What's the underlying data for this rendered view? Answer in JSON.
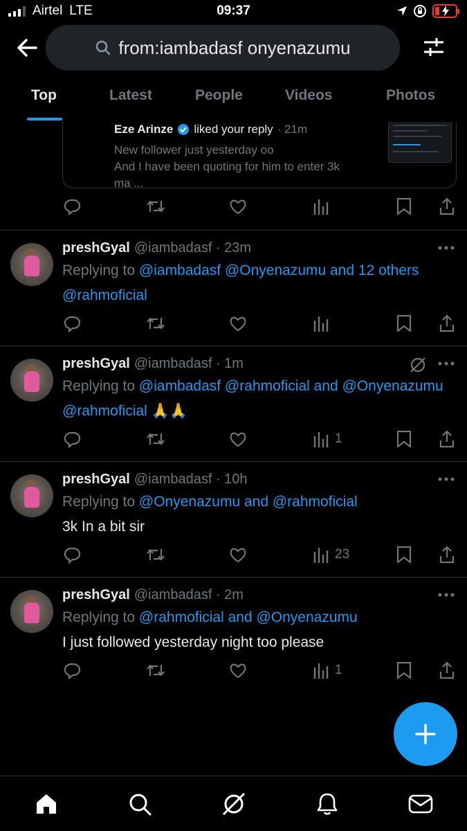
{
  "status_bar": {
    "carrier": "Airtel",
    "network": "LTE",
    "time": "09:37"
  },
  "search": {
    "query": "from:iambadasf onyenazumu"
  },
  "tabs": [
    {
      "label": "Top",
      "active": true
    },
    {
      "label": "Latest",
      "active": false
    },
    {
      "label": "People",
      "active": false
    },
    {
      "label": "Videos",
      "active": false
    },
    {
      "label": "Photos",
      "active": false
    }
  ],
  "quoted_card": {
    "name": "Eze Arinze",
    "action": "liked your reply",
    "time": "· 21m",
    "line1": "New follower just yesterday oo",
    "line2": "And I have been quoting for him to enter 3k",
    "line3": "ma ..."
  },
  "tweets": [
    {
      "name": "preshGyal",
      "meta": "@iambadasf · 23m",
      "replying_prefix": "Replying to ",
      "replying_links": "@iambadasf @Onyenazumu and 12 others",
      "body_link": "@rahmoficial",
      "body_text": "",
      "views": ""
    },
    {
      "name": "preshGyal",
      "meta": "@iambadasf · 1m",
      "replying_prefix": "Replying to ",
      "replying_links": "@iambadasf @rahmoficial and @Onyenazumu",
      "body_link": "@rahmoficial",
      "body_text": " 🙏🙏",
      "views": "1"
    },
    {
      "name": "preshGyal",
      "meta": "@iambadasf · 10h",
      "replying_prefix": "Replying to ",
      "replying_links": "@Onyenazumu and @rahmoficial",
      "body_link": "",
      "body_text": "3k In a bit sir",
      "views": "23"
    },
    {
      "name": "preshGyal",
      "meta": "@iambadasf · 2m",
      "replying_prefix": "Replying to ",
      "replying_links": "@rahmoficial and @Onyenazumu",
      "body_link": "",
      "body_text": "I just followed yesterday night too please",
      "views": "1"
    }
  ],
  "colors": {
    "accent": "#1d9bf0",
    "muted": "#71767b",
    "divider": "#2f3336",
    "battery_low": "#ee3333"
  },
  "icons": {
    "nav": [
      "home-icon",
      "search-icon",
      "grok-icon",
      "notifications-icon",
      "messages-icon"
    ],
    "actions": [
      "reply-icon",
      "retweet-icon",
      "like-icon",
      "views-icon",
      "bookmark-icon",
      "share-icon"
    ]
  }
}
